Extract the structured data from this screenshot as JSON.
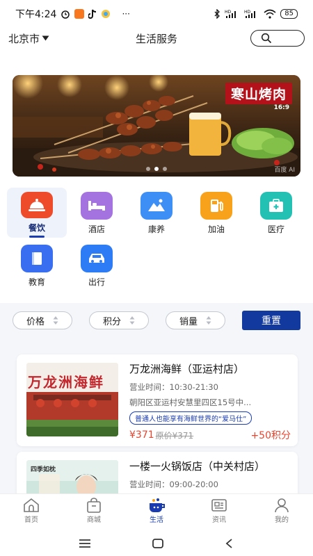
{
  "status_bar": {
    "time": "下午4:24",
    "battery": "85",
    "icons": [
      "alarm-icon",
      "xiaomi-app-icon",
      "tiktok-icon",
      "browser-icon",
      "more-dots-icon",
      "bluetooth-icon",
      "signal-hd-icon",
      "signal-hd-icon",
      "wifi-icon",
      "battery-icon"
    ],
    "more": "···"
  },
  "header": {
    "city": "北京市",
    "title": "生活服务",
    "search_icon": "search-icon"
  },
  "banner": {
    "title": "寒山烤肉",
    "ratio": "16:9",
    "watermark": "百度 AI",
    "dots": 3,
    "active_dot": 1
  },
  "categories": [
    {
      "label": "餐饮",
      "icon": "dining-cloche-icon",
      "color": "#ee4b2b",
      "selected": true
    },
    {
      "label": "酒店",
      "icon": "bed-icon",
      "color": "#a473e0",
      "selected": false
    },
    {
      "label": "康养",
      "icon": "mountain-icon",
      "color": "#3d8ff5",
      "selected": false
    },
    {
      "label": "加油",
      "icon": "fuel-pump-icon",
      "color": "#f7a21a",
      "selected": false
    },
    {
      "label": "医疗",
      "icon": "medical-kit-icon",
      "color": "#22c1b4",
      "selected": false
    },
    {
      "label": "教育",
      "icon": "book-icon",
      "color": "#3a6ef0",
      "selected": false
    },
    {
      "label": "出行",
      "icon": "car-icon",
      "color": "#2d7cf5",
      "selected": false
    }
  ],
  "filters": {
    "sorts": [
      "价格",
      "积分",
      "销量"
    ],
    "reset_label": "重置",
    "accent": "#123a9e"
  },
  "stores": [
    {
      "name": "万龙洲海鲜（亚运村店）",
      "hours": "营业时间：10:30-21:30",
      "address": "朝阳区亚运村安慧里四区15号中...",
      "tag": "普通人也能享有海鲜世界的“爱马仕”",
      "price": "¥371",
      "original_price": "原价¥371",
      "points": "+50积分",
      "image_text": "万龙洲海鲜"
    },
    {
      "name": "一楼一火锅饭店（中关村店）",
      "hours": "营业时间：09:00-20:00",
      "image_text": "四季如枕"
    }
  ],
  "tabs": [
    {
      "label": "首页",
      "icon": "home-icon",
      "active": false
    },
    {
      "label": "商城",
      "icon": "shopping-bag-icon",
      "active": false
    },
    {
      "label": "生活",
      "icon": "life-cup-icon",
      "active": true
    },
    {
      "label": "资讯",
      "icon": "news-icon",
      "active": false
    },
    {
      "label": "我的",
      "icon": "profile-icon",
      "active": false
    }
  ],
  "system_nav": [
    "menu-icon",
    "home-square-icon",
    "back-icon"
  ]
}
